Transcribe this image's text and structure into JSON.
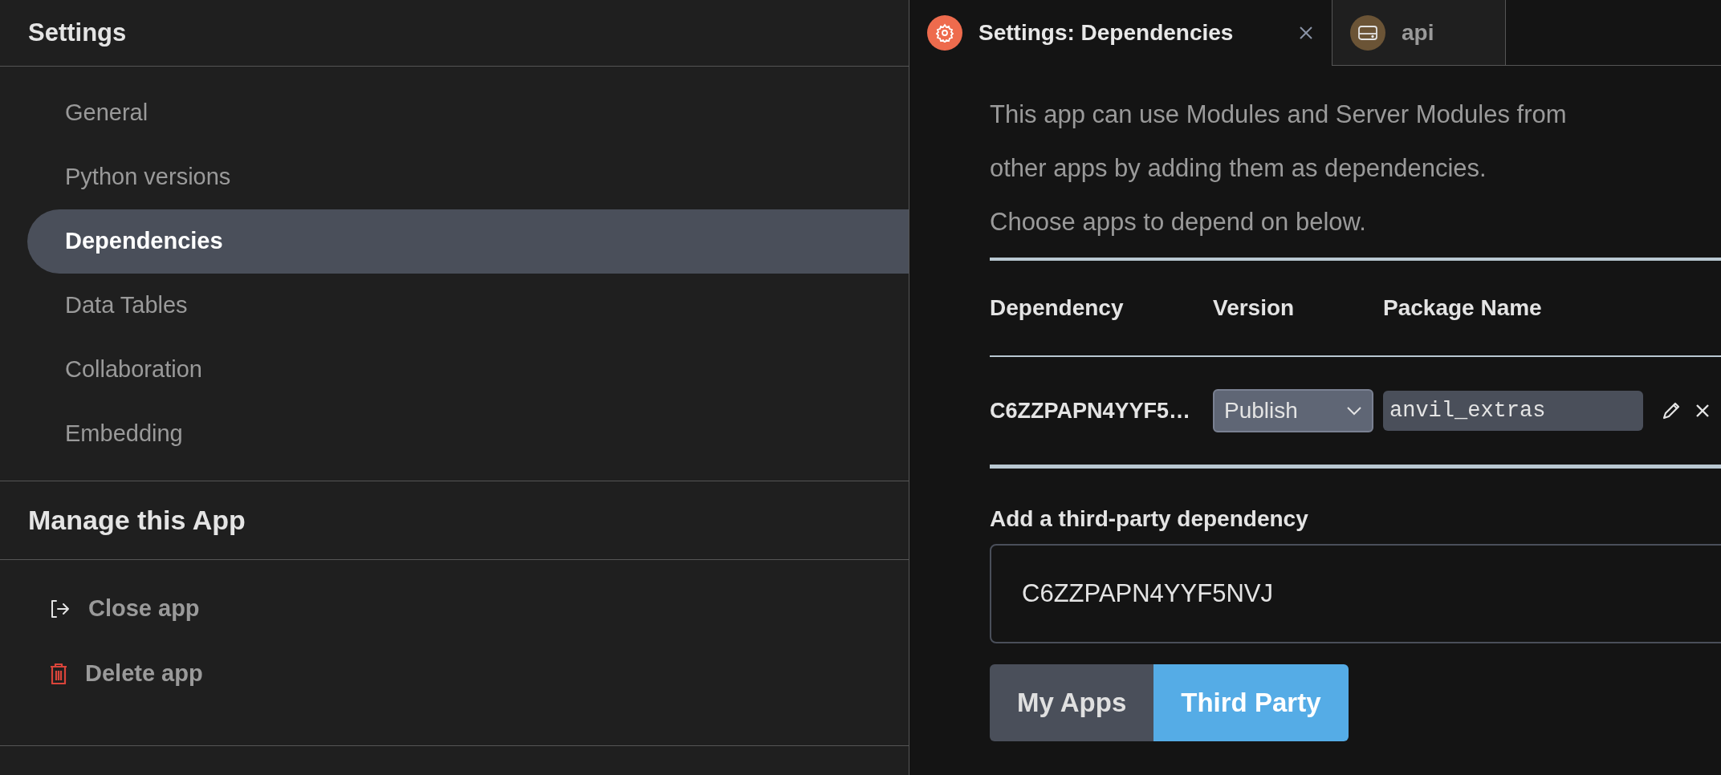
{
  "sidebar": {
    "title": "Settings",
    "items": [
      {
        "label": "General",
        "selected": false
      },
      {
        "label": "Python versions",
        "selected": false
      },
      {
        "label": "Dependencies",
        "selected": true
      },
      {
        "label": "Data Tables",
        "selected": false
      },
      {
        "label": "Collaboration",
        "selected": false
      },
      {
        "label": "Embedding",
        "selected": false
      }
    ],
    "manage_title": "Manage this App",
    "manage_items": [
      {
        "kind": "close",
        "label": "Close app"
      },
      {
        "kind": "delete",
        "label": "Delete app"
      }
    ]
  },
  "tabs": [
    {
      "kind": "settings",
      "label": "Settings: Dependencies",
      "selected": true,
      "closable": true
    },
    {
      "kind": "server",
      "label": "api",
      "selected": false,
      "closable": false
    }
  ],
  "description": [
    "This app can use Modules and Server Modules from",
    "other apps by adding them as dependencies.",
    "Choose apps to depend on below."
  ],
  "table": {
    "columns": [
      "Dependency",
      "Version",
      "Package Name"
    ],
    "rows": [
      {
        "dependency": "C6ZZPAPN4YYF5…",
        "version": "Publish",
        "package_name": "anvil_extras"
      }
    ]
  },
  "add_label": "Add a third-party dependency",
  "add_value": "C6ZZPAPN4YYF5NVJ",
  "source_buttons": [
    {
      "label": "My Apps",
      "selected": false
    },
    {
      "label": "Third Party",
      "selected": true
    }
  ]
}
